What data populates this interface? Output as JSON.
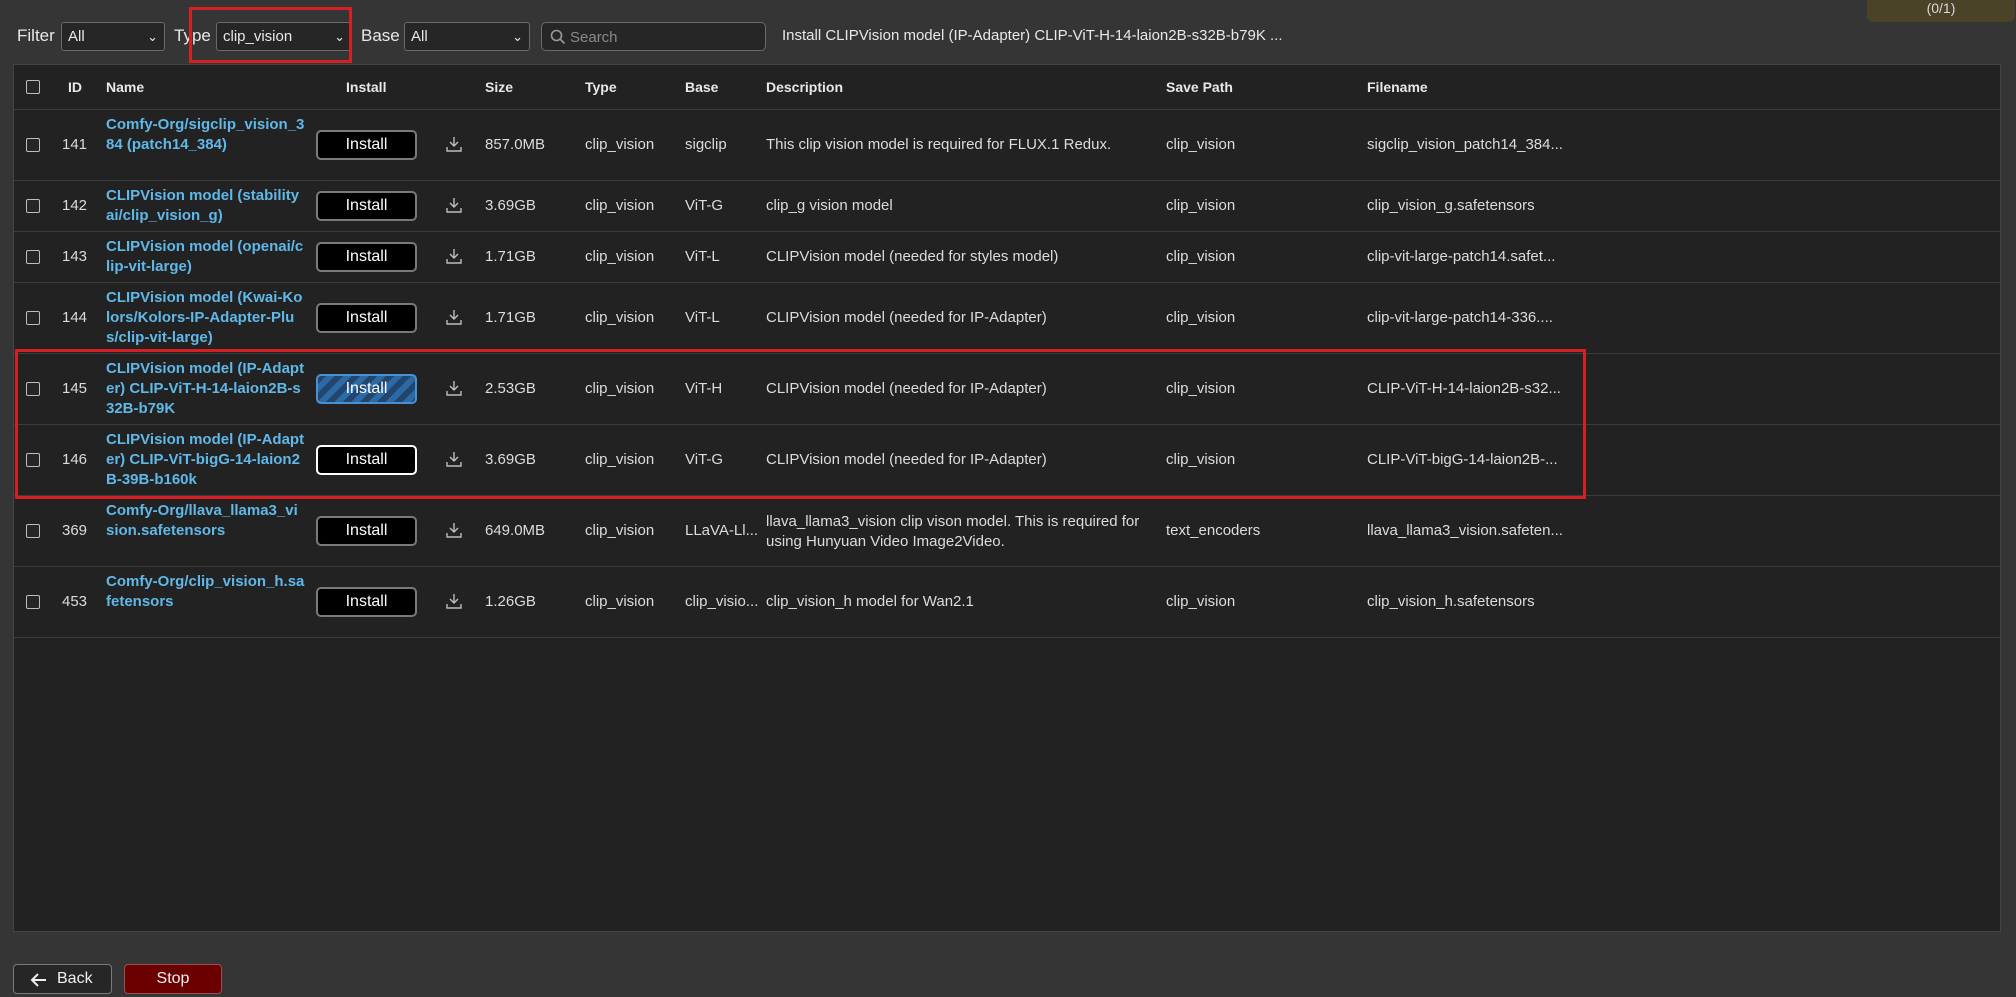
{
  "filters": {
    "filter_label": "Filter",
    "filter_value": "All",
    "type_label": "Type",
    "type_value": "clip_vision",
    "base_label": "Base",
    "base_value": "All",
    "search_placeholder": "Search"
  },
  "status_message": "Install CLIPVision model (IP-Adapter) CLIP-ViT-H-14-laion2B-s32B-b79K ...",
  "counter": "(0/1)",
  "columns": {
    "id": "ID",
    "name": "Name",
    "install": "Install",
    "size": "Size",
    "type": "Type",
    "base": "Base",
    "description": "Description",
    "save_path": "Save Path",
    "filename": "Filename"
  },
  "rows": [
    {
      "id": "141",
      "name": "Comfy-Org/sigclip_vision_384 (patch14_384)",
      "install": "Install",
      "size": "857.0MB",
      "type": "clip_vision",
      "base": "sigclip",
      "description": "This clip vision model is required for FLUX.1 Redux.",
      "save_path": "clip_vision",
      "filename": "sigclip_vision_patch14_384..."
    },
    {
      "id": "142",
      "name": "CLIPVision model (stabilityai/clip_vision_g)",
      "install": "Install",
      "size": "3.69GB",
      "type": "clip_vision",
      "base": "ViT-G",
      "description": "clip_g vision model",
      "save_path": "clip_vision",
      "filename": "clip_vision_g.safetensors"
    },
    {
      "id": "143",
      "name": "CLIPVision model (openai/clip-vit-large)",
      "install": "Install",
      "size": "1.71GB",
      "type": "clip_vision",
      "base": "ViT-L",
      "description": "CLIPVision model (needed for styles model)",
      "save_path": "clip_vision",
      "filename": "clip-vit-large-patch14.safet..."
    },
    {
      "id": "144",
      "name": "CLIPVision model (Kwai-Kolors/Kolors-IP-Adapter-Plus/clip-vit-large)",
      "install": "Install",
      "size": "1.71GB",
      "type": "clip_vision",
      "base": "ViT-L",
      "description": "CLIPVision model (needed for IP-Adapter)",
      "save_path": "clip_vision",
      "filename": "clip-vit-large-patch14-336...."
    },
    {
      "id": "145",
      "name": "CLIPVision model (IP-Adapter) CLIP-ViT-H-14-laion2B-s32B-b79K",
      "install": "Install",
      "size": "2.53GB",
      "type": "clip_vision",
      "base": "ViT-H",
      "description": "CLIPVision model (needed for IP-Adapter)",
      "save_path": "clip_vision",
      "filename": "CLIP-ViT-H-14-laion2B-s32..."
    },
    {
      "id": "146",
      "name": "CLIPVision model (IP-Adapter) CLIP-ViT-bigG-14-laion2B-39B-b160k",
      "install": "Install",
      "size": "3.69GB",
      "type": "clip_vision",
      "base": "ViT-G",
      "description": "CLIPVision model (needed for IP-Adapter)",
      "save_path": "clip_vision",
      "filename": "CLIP-ViT-bigG-14-laion2B-..."
    },
    {
      "id": "369",
      "name": "Comfy-Org/llava_llama3_vision.safetensors",
      "install": "Install",
      "size": "649.0MB",
      "type": "clip_vision",
      "base": "LLaVA-Ll...",
      "description": "llava_llama3_vision clip vison model. This is required for using Hunyuan Video Image2Video.",
      "save_path": "text_encoders",
      "filename": "llava_llama3_vision.safeten..."
    },
    {
      "id": "453",
      "name": "Comfy-Org/clip_vision_h.safetensors",
      "install": "Install",
      "size": "1.26GB",
      "type": "clip_vision",
      "base": "clip_visio...",
      "description": "clip_vision_h model for Wan2.1",
      "save_path": "clip_vision",
      "filename": "clip_vision_h.safetensors"
    }
  ],
  "footer": {
    "back_label": "Back",
    "stop_label": "Stop"
  },
  "colors": {
    "accent_link": "#5fb8e8",
    "highlight_red": "#d42025",
    "stop_bg": "#6b0000"
  }
}
